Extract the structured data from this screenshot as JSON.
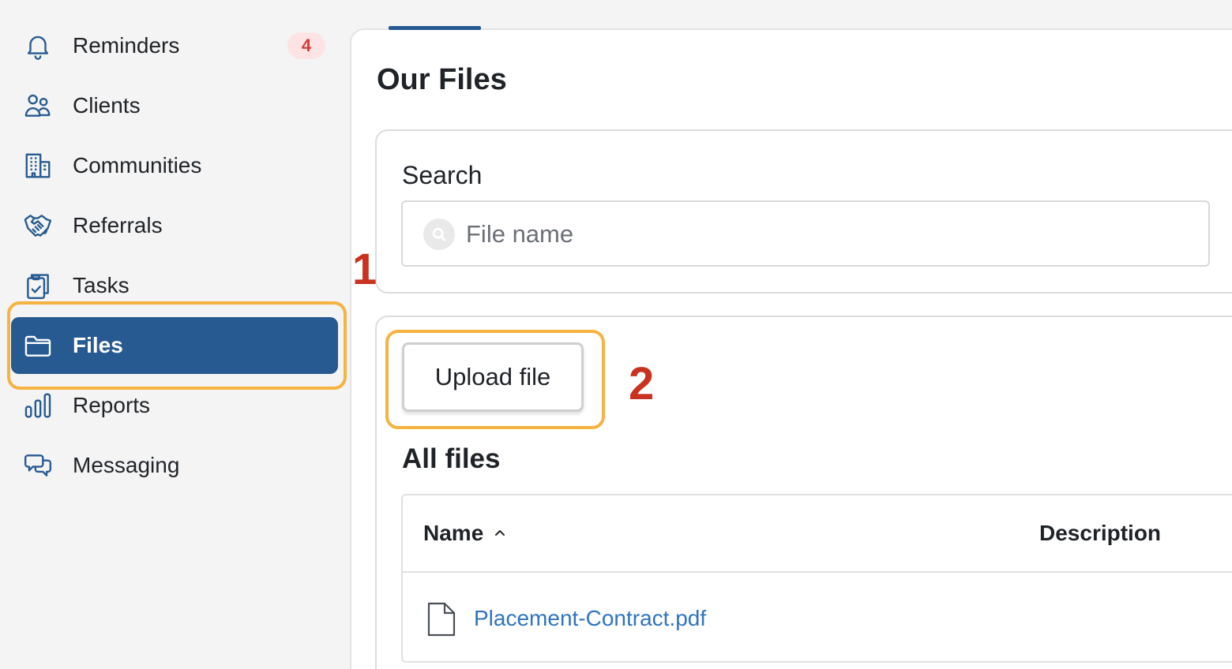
{
  "sidebar": {
    "items": [
      {
        "label": "Reminders",
        "icon": "bell-icon",
        "badge": "4"
      },
      {
        "label": "Clients",
        "icon": "users-icon"
      },
      {
        "label": "Communities",
        "icon": "building-icon"
      },
      {
        "label": "Referrals",
        "icon": "handshake-icon"
      },
      {
        "label": "Tasks",
        "icon": "clipboard-check-icon"
      },
      {
        "label": "Files",
        "icon": "folder-icon",
        "active": true
      },
      {
        "label": "Reports",
        "icon": "bar-chart-icon"
      },
      {
        "label": "Messaging",
        "icon": "chat-bubbles-icon"
      }
    ]
  },
  "main": {
    "title": "Our Files",
    "search": {
      "label": "Search",
      "placeholder": "File name",
      "value": ""
    },
    "upload_button": "Upload file",
    "section_title": "All files",
    "table": {
      "columns": [
        "Name",
        "Description"
      ],
      "sort": {
        "column": "Name",
        "direction": "ascending"
      },
      "rows": [
        {
          "name": "Placement-Contract.pdf",
          "description": ""
        }
      ]
    }
  },
  "annotations": {
    "step1": "1",
    "step2": "2"
  },
  "colors": {
    "primary": "#265a91",
    "highlight": "#f5b342",
    "annotation": "#c8321f",
    "badge_bg": "#fde3e3",
    "badge_text": "#d63b3b",
    "link": "#2f74c0"
  }
}
